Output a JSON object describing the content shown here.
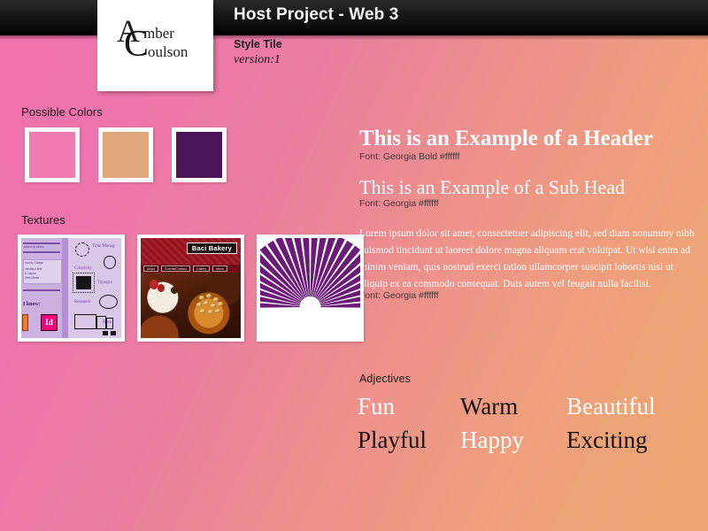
{
  "header": {
    "project_title": "Host Project - Web 3",
    "tile_label": "Style Tile",
    "version": "version:1",
    "logo": {
      "monogram_a": "A",
      "monogram_c": "C",
      "name_first": "mber",
      "name_last": "oulson"
    }
  },
  "sections": {
    "colors_heading": "Possible Colors",
    "textures_heading": "Textures",
    "adjectives_heading": "Adjectives"
  },
  "colors": {
    "swatches": [
      {
        "name": "pink",
        "hex": "#ef7bb0"
      },
      {
        "name": "tan",
        "hex": "#dfa77a"
      },
      {
        "name": "purple",
        "hex": "#4a1458"
      }
    ],
    "background_start": "#f272ae",
    "background_end": "#eda672",
    "topbar": "#000000",
    "text_light": "#ffffff",
    "text_dark": "#141414"
  },
  "textures": [
    {
      "name": "portfolio-purple-page",
      "nav_words": [
        "Time Manag",
        "Creativity",
        "Typogra",
        "Research",
        "Resp"
      ],
      "sidebar_lines": [
        "spired by others.",
        "munity College",
        "unication Arts",
        "& Layout",
        "Web Media"
      ],
      "headline": "I know:",
      "badge": "Id"
    },
    {
      "name": "baci-bakery-site",
      "title": "Baci Bakery",
      "nav": [
        "About",
        "Events/Contact",
        "Gallery",
        "Menu"
      ]
    },
    {
      "name": "purple-sunburst",
      "rays": 26,
      "color": "#6b1a78"
    }
  ],
  "typography": {
    "header_sample": "This is an Example of a Header",
    "header_note": "Font: Georgia Bold #ffffff",
    "subhead_sample": "This is an Example of a Sub Head",
    "subhead_note": "Font: Georgia #ffffff",
    "body_sample": "Lorem ipsum dolor sit amet, consectetuer adipiscing elit, sed diam nonummy nibh euismod tincidunt ut laoreet dolore magna aliquam erat volutpat. Ut wisi enim ad minim veniam, quis nostrud exerci tation ullamcorper suscipit lobortis nisl ut aliquip ex ea commodo consequat. Duis autem vel feugait nulla facilisi.",
    "body_note": "Font: Georgia #ffffff"
  },
  "adjectives": [
    {
      "word": "Fun",
      "tone": "light"
    },
    {
      "word": "Warm",
      "tone": "dark"
    },
    {
      "word": "Beautiful",
      "tone": "light"
    },
    {
      "word": "Playful",
      "tone": "dark"
    },
    {
      "word": "Happy",
      "tone": "light"
    },
    {
      "word": "Exciting",
      "tone": "dark"
    }
  ]
}
